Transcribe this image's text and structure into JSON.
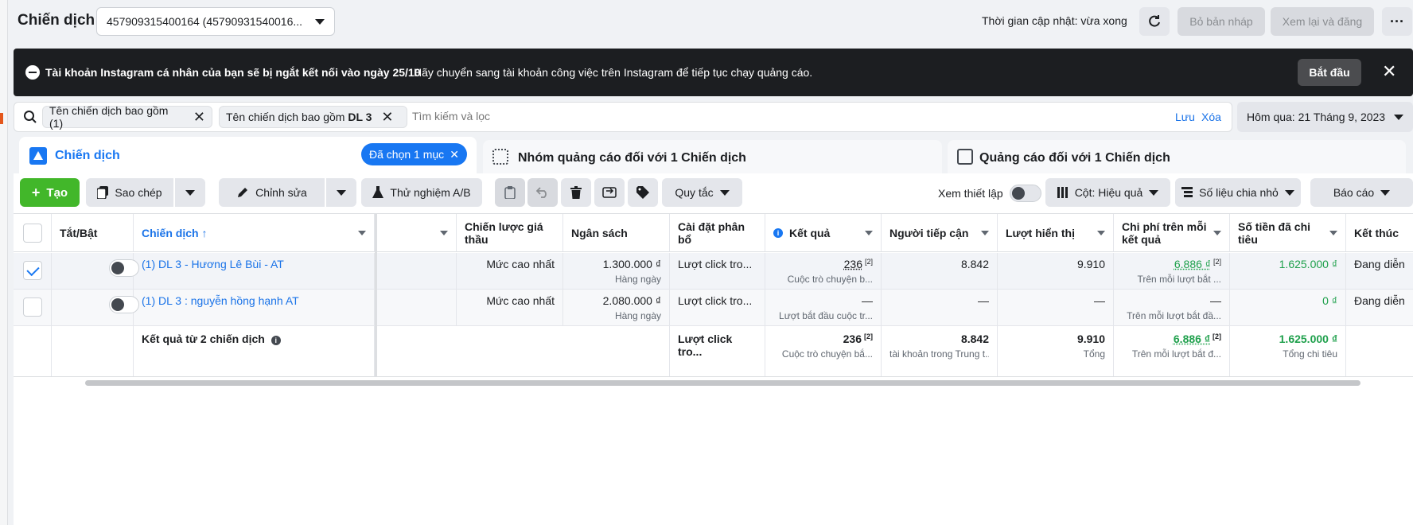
{
  "header": {
    "title": "Chiến dịch",
    "account": "457909315400164 (45790931540016...",
    "update_time": "Thời gian cập nhật: vừa xong",
    "discard_label": "Bỏ bản nháp",
    "review_label": "Xem lại và đăng",
    "more_label": "···"
  },
  "alert": {
    "bold_text": "Tài khoản Instagram cá nhân của bạn sẽ bị ngắt kết nối vào ngày 25/10",
    "text": "Hãy chuyển sang tài khoản công việc trên Instagram để tiếp tục chạy quảng cáo.",
    "start_label": "Bắt đầu",
    "close_label": "✕"
  },
  "filters": {
    "chip1": "Tên chiến dịch bao gồm (1)",
    "chip2_prefix": "Tên chiến dịch bao gồm ",
    "chip2_value": "DL 3",
    "placeholder": "Tìm kiếm và lọc",
    "save_label": "Lưu",
    "clear_label": "Xóa",
    "date_label": "Hôm qua: 21 Tháng 9, 2023"
  },
  "tabs": {
    "campaigns": "Chiến dịch",
    "selected_pill": "Đã chọn 1 mục",
    "adsets": "Nhóm quảng cáo đối với 1 Chiến dịch",
    "ads": "Quảng cáo đối với 1 Chiến dịch"
  },
  "toolbar": {
    "create": "Tạo",
    "copy": "Sao chép",
    "edit": "Chỉnh sửa",
    "ab_test": "Thử nghiệm A/B",
    "rules": "Quy tắc",
    "view_setup": "Xem thiết lập",
    "columns": "Cột: Hiệu quả",
    "breakdown": "Số liệu chia nhỏ",
    "report": "Báo cáo"
  },
  "table": {
    "headers": {
      "toggle": "Tắt/Bật",
      "campaign": "Chiến dịch ↑",
      "bid": "Chiến lược giá thầu",
      "budget": "Ngân sách",
      "attribution": "Cài đặt phân bổ",
      "results": "Kết quả",
      "reach": "Người tiếp cận",
      "impressions": "Lượt hiển thị",
      "cost_per_result": "Chi phí trên mỗi kết quả",
      "amount_spent": "Số tiền đã chi tiêu",
      "ends": "Kết thúc"
    },
    "rows": [
      {
        "name": "(1) DL 3 - Hương Lê Bùi - AT",
        "bid": "Mức cao nhất",
        "budget": "1.300.000 ₫",
        "budget_sub": "Hàng ngày",
        "attribution": "Lượt click tro...",
        "results": "236",
        "results_sup": "[2]",
        "results_sub": "Cuộc trò chuyện b...",
        "reach": "8.842",
        "impressions": "9.910",
        "cpr": "6.886 ₫",
        "cpr_sup": "[2]",
        "cpr_sub": "Trên mỗi lượt bắt ...",
        "spent": "1.625.000 ₫",
        "ends": "Đang diễn"
      },
      {
        "name": "(1) DL 3 : nguyễn hồng hạnh AT",
        "bid": "Mức cao nhất",
        "budget": "2.080.000 ₫",
        "budget_sub": "Hàng ngày",
        "attribution": "Lượt click tro...",
        "results": "—",
        "results_sub": "Lượt bắt đầu cuộc tr...",
        "reach": "—",
        "impressions": "—",
        "cpr": "—",
        "cpr_sub": "Trên mỗi lượt bắt đầ...",
        "spent": "0 ₫",
        "ends": "Đang diễn"
      }
    ],
    "totals": {
      "label": "Kết quả từ 2 chiến dịch",
      "attribution": "Lượt click tro...",
      "results": "236",
      "results_sup": "[2]",
      "results_sub": "Cuộc trò chuyện bắ...",
      "reach": "8.842",
      "reach_sub": "tài khoản trong Trung t...",
      "impressions": "9.910",
      "impressions_sub": "Tổng",
      "cpr": "6.886 ₫",
      "cpr_sup": "[2]",
      "cpr_sub": "Trên mỗi lượt bắt đ...",
      "spent": "1.625.000 ₫",
      "spent_sub": "Tổng chi tiêu"
    }
  },
  "colors": {
    "primary": "#1877f2",
    "create_green": "#42b72a",
    "alert_bg": "#1c1e21",
    "spent_green": "#1fa04c"
  }
}
